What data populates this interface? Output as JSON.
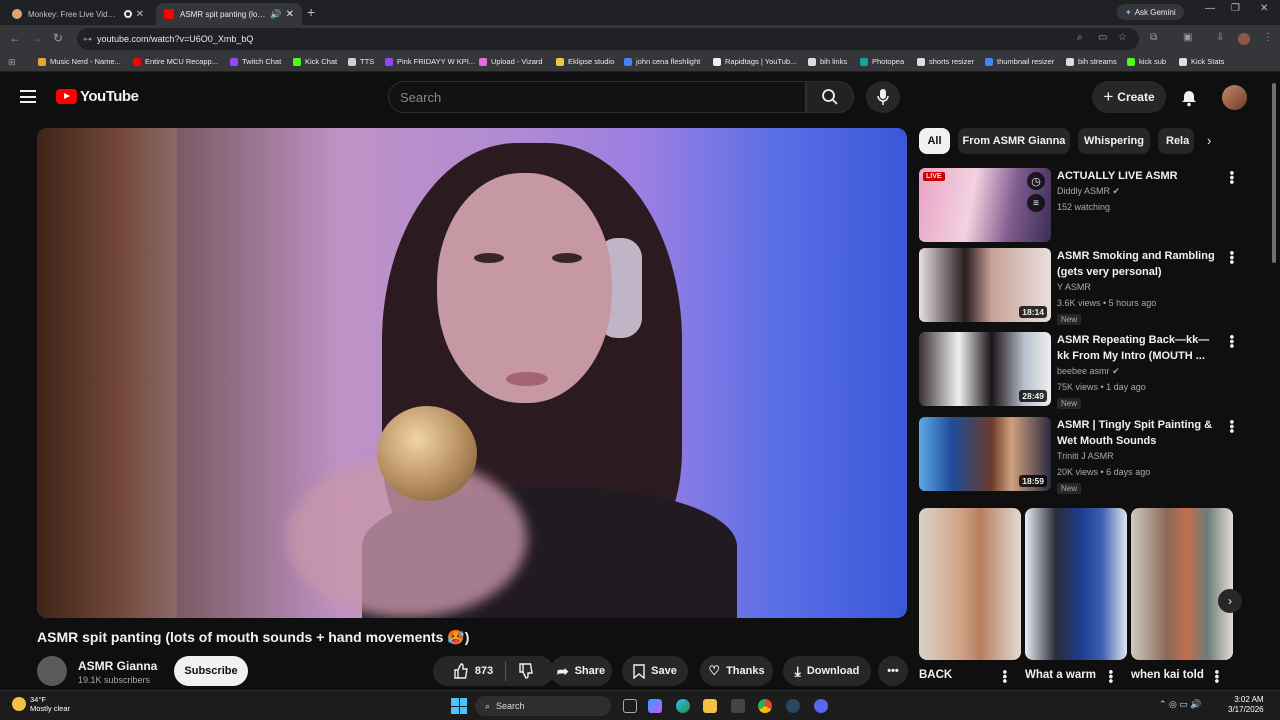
{
  "browser": {
    "tabs": [
      {
        "title": "Monkey: Free Live Video Ch",
        "active": false
      },
      {
        "title": "ASMR spit panting (lots of",
        "active": true
      }
    ],
    "new_tab": "+",
    "gemini": "Ask Gemini",
    "url": "youtube.com/watch?v=U6O0_Xmb_bQ",
    "bookmarks": [
      {
        "label": "Music Nerd - Name...",
        "color": "#e8a33d"
      },
      {
        "label": "Entire MCU Recapp...",
        "color": "#ff0000"
      },
      {
        "label": "Twitch Chat",
        "color": "#9146ff"
      },
      {
        "label": "Kick Chat",
        "color": "#53fc18"
      },
      {
        "label": "TTS",
        "color": "#cfcfcf"
      },
      {
        "label": "Pink FRIDAYY W KPI...",
        "color": "#9146ff"
      },
      {
        "label": "Upload - Vizard",
        "color": "#e86bd6"
      },
      {
        "label": "Eklipse studio",
        "color": "#f3c244"
      },
      {
        "label": "john cena fleshlight",
        "color": "#4285f4"
      },
      {
        "label": "Rapidtags | YouTub...",
        "color": "#eeeeee"
      },
      {
        "label": "bih links",
        "color": "#dddddd"
      },
      {
        "label": "Photopea",
        "color": "#18a497"
      },
      {
        "label": "shorts resizer",
        "color": "#dddddd"
      },
      {
        "label": "thumbnail resizer",
        "color": "#4285f4"
      },
      {
        "label": "bih streams",
        "color": "#dddddd"
      },
      {
        "label": "kick sub",
        "color": "#53fc18"
      },
      {
        "label": "Kick Stats",
        "color": "#dddddd"
      }
    ]
  },
  "youtube": {
    "logo": "YouTube",
    "search_placeholder": "Search",
    "create_label": "Create",
    "video": {
      "title": "ASMR spit panting (lots of mouth sounds + hand movements 🥵)",
      "channel": "ASMR Gianna",
      "subscribers": "19.1K subscribers",
      "subscribe_label": "Subscribe",
      "likes": "873",
      "share_label": "Share",
      "save_label": "Save",
      "thanks_label": "Thanks",
      "download_label": "Download"
    },
    "chips": [
      "All",
      "From ASMR Gianna",
      "Whispering",
      "Rela"
    ],
    "recommendations": [
      {
        "title": "ACTUALLY LIVE ASMR",
        "channel": "Diddly ASMR",
        "verified": true,
        "meta": "152 watching",
        "badge": "LIVE",
        "duration": "",
        "is_new": false
      },
      {
        "title": "ASMR Smoking and Rambling (gets very personal)",
        "channel": "Y ASMR",
        "verified": false,
        "meta": "3.6K views • 5 hours ago",
        "badge": "",
        "duration": "18:14",
        "is_new": true
      },
      {
        "title": "ASMR Repeating Back—kk—kk From My Intro (MOUTH ...",
        "channel": "beebee asmr",
        "verified": true,
        "meta": "75K views • 1 day ago",
        "badge": "",
        "duration": "28:49",
        "is_new": true
      },
      {
        "title": "ASMR | Tingly Spit Painting & Wet Mouth Sounds",
        "channel": "Triniti J ASMR",
        "verified": false,
        "meta": "20K views • 6 days ago",
        "badge": "",
        "duration": "18:59",
        "is_new": true
      }
    ],
    "new_label": "New",
    "shorts": [
      {
        "title": "BACK"
      },
      {
        "title": "What a warm"
      },
      {
        "title": "when kai told"
      }
    ]
  },
  "taskbar": {
    "temperature": "34°F",
    "condition": "Mostly clear",
    "search_label": "Search",
    "time": "3:02 AM",
    "date": "3/17/2026"
  }
}
